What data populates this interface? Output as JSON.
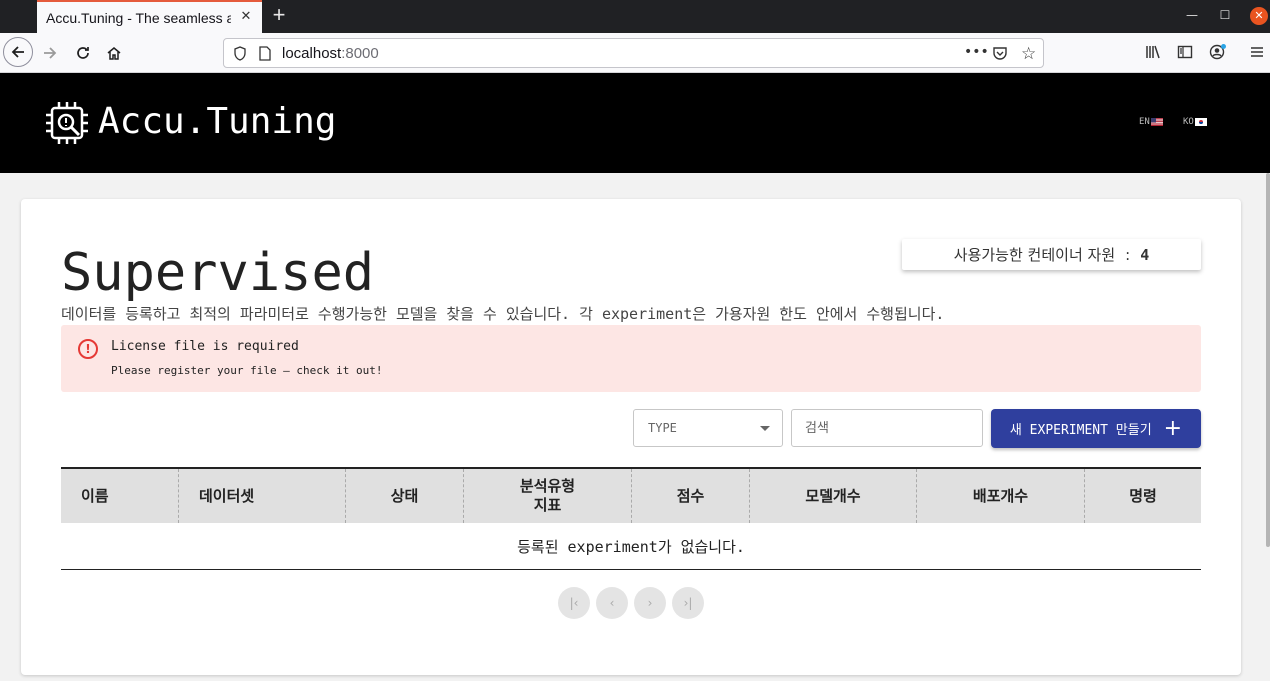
{
  "browser": {
    "tab_title": "Accu.Tuning - The seamless a",
    "url_host": "localhost",
    "url_port": ":8000"
  },
  "header": {
    "brand": "Accu.Tuning",
    "lang_en": "EN",
    "lang_ko": "KO"
  },
  "page": {
    "title": "Supervised",
    "description": "데이터를 등록하고 최적의 파라미터로 수행가능한 모델을 찾을 수 있습니다. 각 experiment은 가용자원 한도 안에서 수행됩니다.",
    "resource_label": "사용가능한 컨테이너 자원",
    "resource_sep": ":",
    "resource_count": "4"
  },
  "alert": {
    "title": "License file is required",
    "message": "Please register your file — check it out!"
  },
  "toolbar": {
    "type_label": "TYPE",
    "search_placeholder": "검색",
    "new_button_label": "새 EXPERIMENT 만들기"
  },
  "table": {
    "columns": [
      "이름",
      "데이터셋",
      "상태",
      "분석유형\n지표",
      "점수",
      "모델개수",
      "배포개수",
      "명령"
    ],
    "empty_message": "등록된 experiment가 없습니다."
  },
  "pagination": {
    "first": "|‹",
    "prev": "‹",
    "next": "›",
    "last": "›|"
  }
}
